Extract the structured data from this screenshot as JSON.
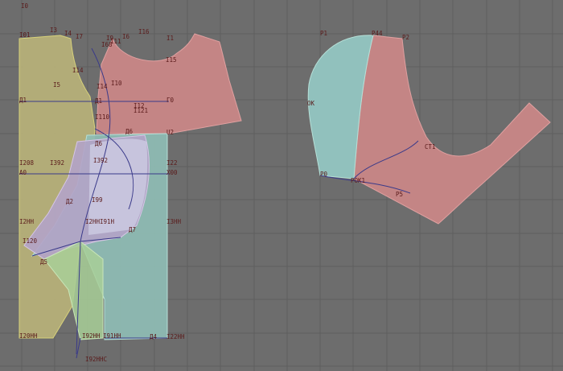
{
  "colors": {
    "background": "#6d6d6d",
    "grid": "#5e5e5e",
    "front": "#b9b27a",
    "back_yoke": "#c98787",
    "side": "#8fbdb5",
    "insert": "#b3a3c8",
    "sleeve_left": "#94c6c2",
    "sleeve_right": "#c98787",
    "label": "#5a1a1a",
    "curve": "#3a3a8a"
  },
  "labels": {
    "t0": "I0",
    "t01": "I01",
    "t3": "I3",
    "t4": "I4",
    "t7": "I7",
    "t9": "I9",
    "t6": "I6",
    "t16": "I16",
    "t1": "I1",
    "t11": "I11",
    "t68": "I68",
    "t15": "I15",
    "t5": "I5",
    "t14": "I14",
    "t10": "I10",
    "tD1": "Д1",
    "t12": "I12",
    "t121": "I121",
    "tG0": "Г0",
    "t110": "I110",
    "tU2": "U2",
    "tD6": "Д6",
    "t208": "I208",
    "t392": "I392",
    "t22": "I22",
    "tA0": "А0",
    "t300": "Х00",
    "t2hh": "I2НН",
    "t91h": "I91Н",
    "t3hh": "I3НН",
    "t120": "I120",
    "tD5": "Д5",
    "tD7": "Д7",
    "tD2": "Д2",
    "t99": "I99",
    "t20hh": "I20НН",
    "t92hh": "I92НН",
    "t91hh": "I91НН",
    "tD4": "Д4",
    "t22hh": "I22НН",
    "t92hhc": "I92ННС",
    "r_p1": "Р1",
    "r_p44": "Р44",
    "r_p2": "Р2",
    "r_ok": "ОК",
    "r_ct1": "СТ1",
    "r_p0": "Р0",
    "r_pok1": "РОК1",
    "r_p5": "Р5"
  }
}
